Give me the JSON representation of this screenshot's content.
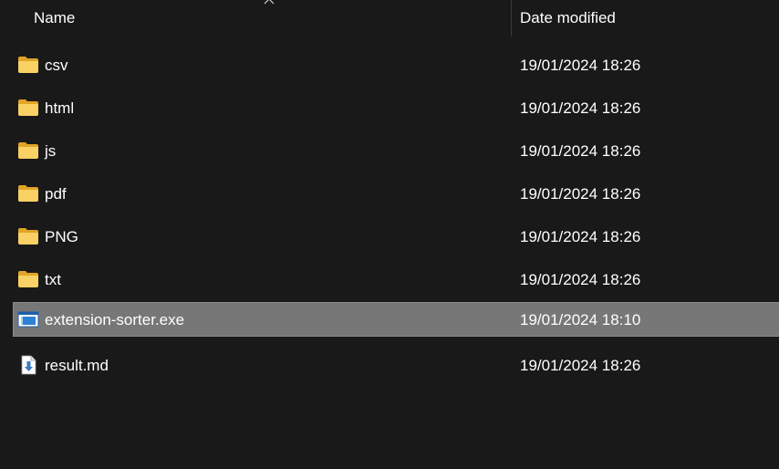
{
  "columns": {
    "name": "Name",
    "date_modified": "Date modified",
    "sort_indicator": "chevron-up-icon"
  },
  "colors": {
    "background": "#191919",
    "selected_row": "#777777",
    "folder": "#f5c542"
  },
  "files": [
    {
      "name": "csv",
      "date": "19/01/2024 18:26",
      "icon": "folder-icon",
      "selected": false
    },
    {
      "name": "html",
      "date": "19/01/2024 18:26",
      "icon": "folder-icon",
      "selected": false
    },
    {
      "name": "js",
      "date": "19/01/2024 18:26",
      "icon": "folder-icon",
      "selected": false
    },
    {
      "name": "pdf",
      "date": "19/01/2024 18:26",
      "icon": "folder-icon",
      "selected": false
    },
    {
      "name": "PNG",
      "date": "19/01/2024 18:26",
      "icon": "folder-icon",
      "selected": false
    },
    {
      "name": "txt",
      "date": "19/01/2024 18:26",
      "icon": "folder-icon",
      "selected": false
    },
    {
      "name": "extension-sorter.exe",
      "date": "19/01/2024 18:10",
      "icon": "executable-icon",
      "selected": true
    },
    {
      "name": "result.md",
      "date": "19/01/2024 18:26",
      "icon": "markdown-file-icon",
      "selected": false
    }
  ]
}
